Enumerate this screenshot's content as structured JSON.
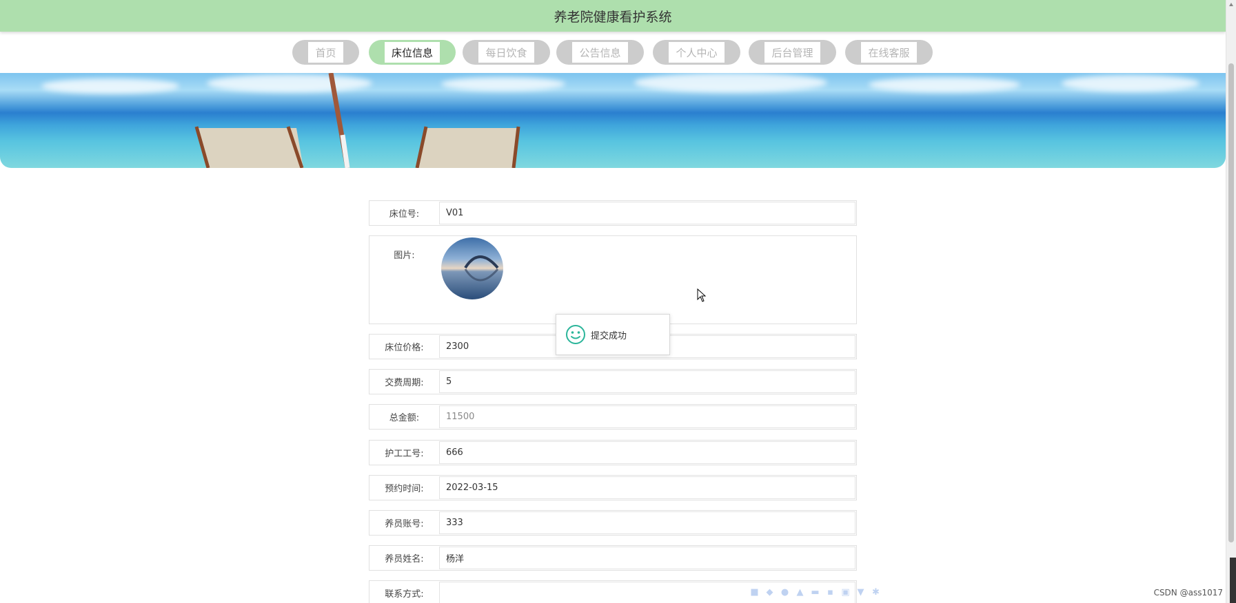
{
  "header": {
    "title": "养老院健康看护系统"
  },
  "nav": {
    "items": [
      {
        "label": "首页",
        "active": false
      },
      {
        "label": "床位信息",
        "active": true
      },
      {
        "label": "每日饮食",
        "active": false
      },
      {
        "label": "公告信息",
        "active": false
      },
      {
        "label": "个人中心",
        "active": false
      },
      {
        "label": "后台管理",
        "active": false
      },
      {
        "label": "在线客服",
        "active": false
      }
    ]
  },
  "form": {
    "bed_no": {
      "label": "床位号:",
      "value": "V01"
    },
    "image": {
      "label": "图片:"
    },
    "price": {
      "label": "床位价格:",
      "value": "2300"
    },
    "cycle": {
      "label": "交费周期:",
      "value": "5"
    },
    "total": {
      "label": "总金额:",
      "value": "11500"
    },
    "nurse_id": {
      "label": "护工工号:",
      "value": "666"
    },
    "booking_date": {
      "label": "预约时间:",
      "value": "2022-03-15"
    },
    "resident_account": {
      "label": "养员账号:",
      "value": "333"
    },
    "resident_name": {
      "label": "养员姓名:",
      "value": "杨洋"
    },
    "contact": {
      "label": "联系方式:",
      "value": ""
    }
  },
  "toast": {
    "message": "提交成功",
    "icon": "smile-icon",
    "color": "#2bb59a"
  },
  "watermark": "CSDN @ass1017",
  "colors": {
    "accent": "#aedfad",
    "inactive_nav": "#cccccc"
  }
}
